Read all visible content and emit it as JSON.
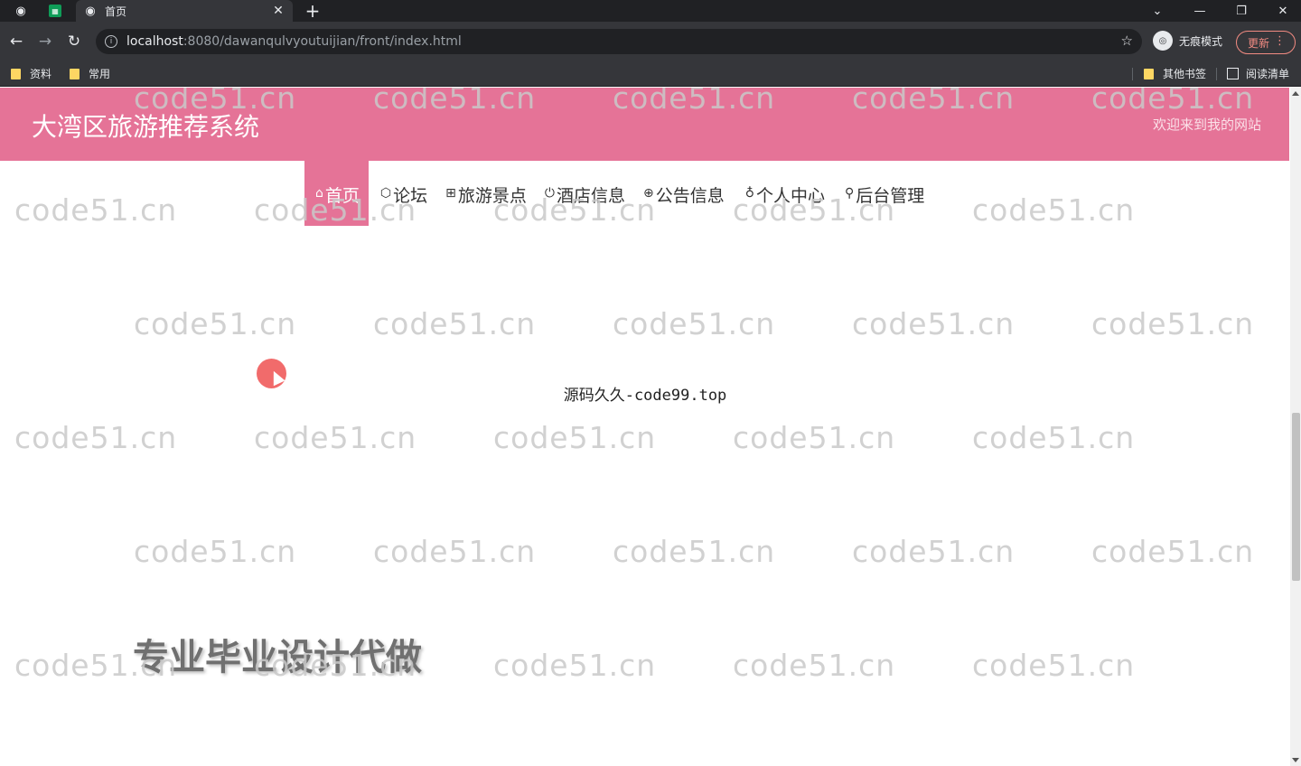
{
  "browser": {
    "tab_title": "首页",
    "url_host": "localhost",
    "url_path": ":8080/dawanqulvyoutuijian/front/index.html",
    "incognito_label": "无痕模式",
    "update_label": "更新",
    "bookmarks": [
      "资料",
      "常用"
    ],
    "bookmarks_right": [
      "其他书签",
      "阅读清单"
    ]
  },
  "site": {
    "title": "大湾区旅游推荐系统",
    "welcome": "欢迎来到我的网站"
  },
  "nav": {
    "items": [
      {
        "icon": "⌂",
        "label": "首页"
      },
      {
        "icon": "⬡",
        "label": "论坛"
      },
      {
        "icon": "⊞",
        "label": "旅游景点"
      },
      {
        "icon": "⏻",
        "label": "酒店信息"
      },
      {
        "icon": "⊕",
        "label": "公告信息"
      },
      {
        "icon": "♁",
        "label": "个人中心"
      },
      {
        "icon": "⚲",
        "label": "后台管理"
      }
    ]
  },
  "content": {
    "center_text": "源码久久-code99.top",
    "big_text": "专业毕业设计代做"
  },
  "watermark_text": "code51.cn",
  "colors": {
    "header_bg": "#e57397",
    "chrome_dark": "#202124",
    "chrome_mid": "#35363a"
  }
}
